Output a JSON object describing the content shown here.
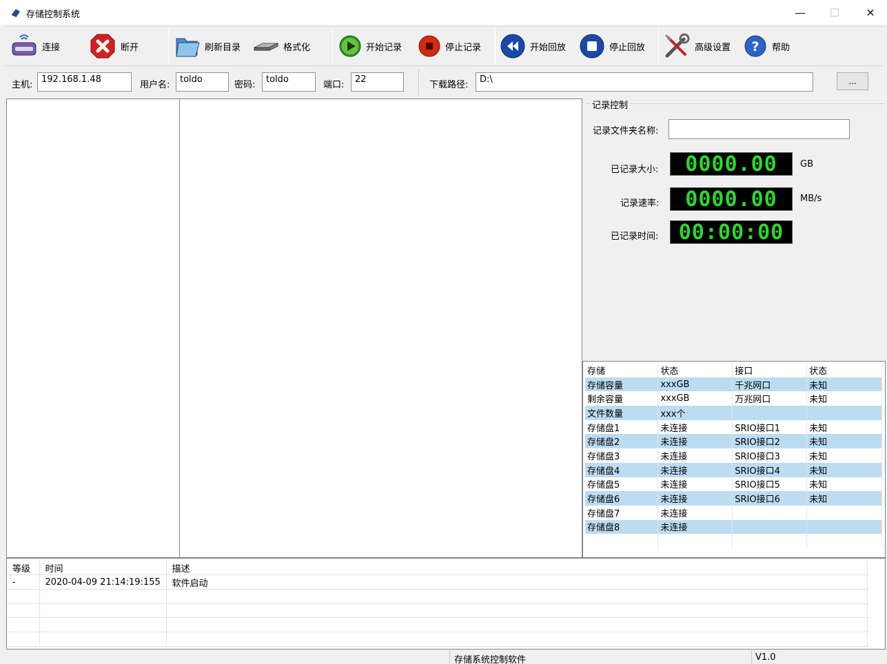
{
  "window": {
    "title": "存储控制系统"
  },
  "toolbar": {
    "connect": "连接",
    "disconnect": "断开",
    "refresh": "刷新目录",
    "format": "格式化",
    "start_record": "开始记录",
    "stop_record": "停止记录",
    "start_playback": "开始回放",
    "stop_playback": "停止回放",
    "advanced": "高级设置",
    "help": "帮助"
  },
  "connection": {
    "host_label": "主机:",
    "host_value": "192.168.1.48",
    "user_label": "用户名:",
    "user_value": "toldo",
    "password_label": "密码:",
    "password_value": "toldo",
    "port_label": "端口:",
    "port_value": "22",
    "download_label": "下载路径:",
    "download_value": "D:\\",
    "browse_label": "..."
  },
  "record_control": {
    "title": "记录控制",
    "folder_label": "记录文件夹名称:",
    "folder_value": "",
    "size_label": "已记录大小:",
    "size_value": "0000.00",
    "size_unit": "GB",
    "rate_label": "记录速率:",
    "rate_value": "0000.00",
    "rate_unit": "MB/s",
    "time_label": "已记录时间:",
    "time_value": "00:00:00"
  },
  "storage_table": {
    "headers": [
      "存储",
      "状态",
      "接口",
      "状态"
    ],
    "rows": [
      [
        "存储容量",
        "xxxGB",
        "千兆网口",
        "未知"
      ],
      [
        "剩余容量",
        "xxxGB",
        "万兆网口",
        "未知"
      ],
      [
        "文件数量",
        "xxx个",
        "",
        ""
      ],
      [
        "存储盘1",
        "未连接",
        "SRIO接口1",
        "未知"
      ],
      [
        "存储盘2",
        "未连接",
        "SRIO接口2",
        "未知"
      ],
      [
        "存储盘3",
        "未连接",
        "SRIO接口3",
        "未知"
      ],
      [
        "存储盘4",
        "未连接",
        "SRIO接口4",
        "未知"
      ],
      [
        "存储盘5",
        "未连接",
        "SRIO接口5",
        "未知"
      ],
      [
        "存储盘6",
        "未连接",
        "SRIO接口6",
        "未知"
      ],
      [
        "存储盘7",
        "未连接",
        "",
        ""
      ],
      [
        "存储盘8",
        "未连接",
        "",
        ""
      ]
    ]
  },
  "log_table": {
    "headers": [
      "等级",
      "时间",
      "描述"
    ],
    "rows": [
      [
        "-",
        "2020-04-09 21:14:19:155",
        "软件启动"
      ]
    ]
  },
  "status_bar": {
    "app_name": "存储系统控制软件",
    "version": "V1.0"
  }
}
